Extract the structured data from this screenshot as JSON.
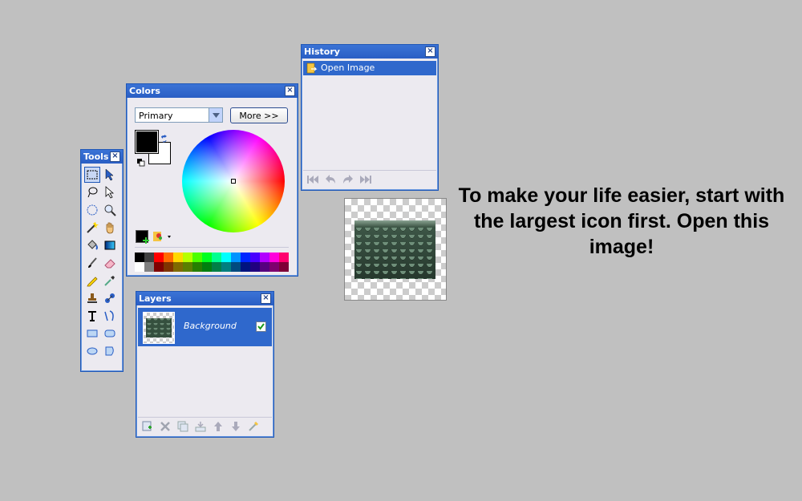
{
  "tools_panel": {
    "title": "Tools",
    "close_label": "×",
    "tools": [
      "rectangle-select-icon",
      "move-selection-icon",
      "lasso-select-icon",
      "move-selected-icon",
      "ellipse-select-icon",
      "zoom-icon",
      "magic-wand-icon",
      "pan-icon",
      "paint-bucket-icon",
      "gradient-icon",
      "paintbrush-icon",
      "eraser-icon",
      "pencil-icon",
      "color-picker-icon",
      "clone-stamp-icon",
      "recolor-icon",
      "text-icon",
      "line-curve-icon",
      "rectangle-icon",
      "rounded-rectangle-icon",
      "ellipse-icon",
      "freeform-shape-icon"
    ]
  },
  "colors_panel": {
    "title": "Colors",
    "close_label": "×",
    "mode_select_value": "Primary",
    "more_button_label": "More >>",
    "primary_color": "#000000",
    "secondary_color": "#ffffff",
    "palette_top": [
      "#000000",
      "#404040",
      "#ff0000",
      "#ff6a00",
      "#ffd800",
      "#b6ff00",
      "#4cff00",
      "#00ff21",
      "#00ff90",
      "#00ffff",
      "#0094ff",
      "#0026ff",
      "#4800ff",
      "#b200ff",
      "#ff00dc",
      "#ff006e"
    ],
    "palette_bottom": [
      "#ffffff",
      "#808080",
      "#7f0000",
      "#7f3300",
      "#7f6a00",
      "#5b7f00",
      "#267f00",
      "#007f0e",
      "#007f46",
      "#007f7f",
      "#004a7f",
      "#00137f",
      "#21007f",
      "#57007f",
      "#7f006e",
      "#7f0037"
    ]
  },
  "history_panel": {
    "title": "History",
    "close_label": "×",
    "items": [
      "Open Image"
    ]
  },
  "layers_panel": {
    "title": "Layers",
    "close_label": "×",
    "layers": [
      {
        "name": "Background",
        "visible": true
      }
    ]
  },
  "instruction_text": "To make your life easier, start with the largest icon first. Open this image!",
  "accent_color": "#2f68cc"
}
